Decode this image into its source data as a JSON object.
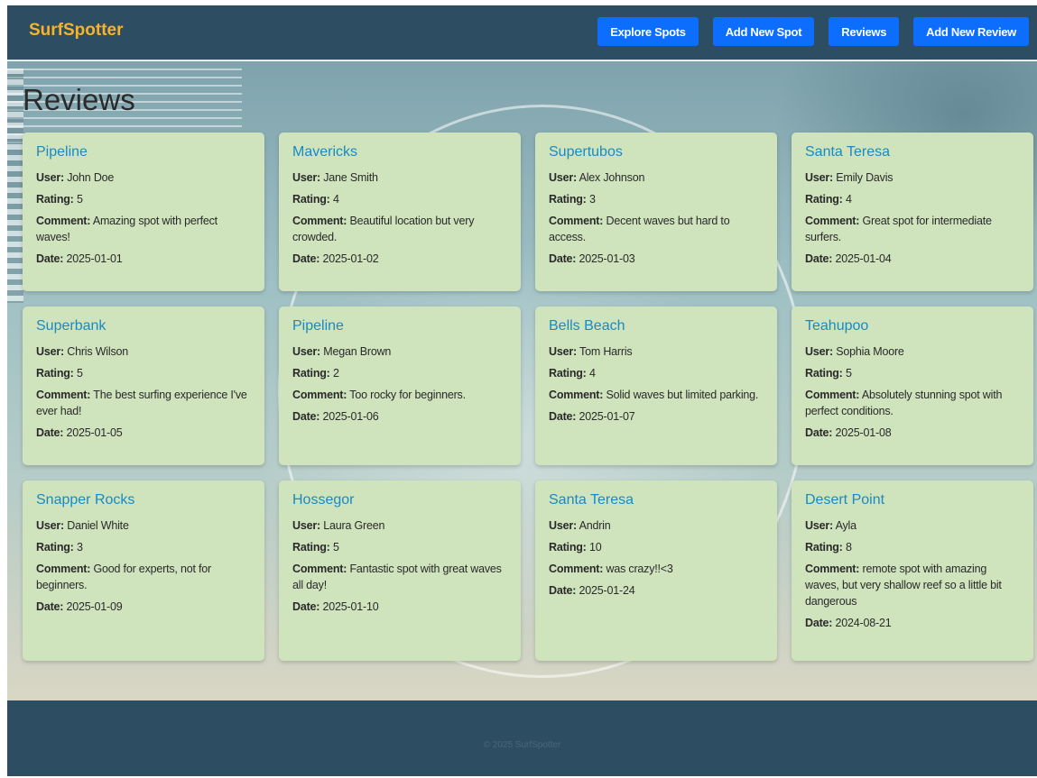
{
  "header": {
    "brand": "SurfSpotter",
    "nav": [
      "Explore Spots",
      "Add New Spot",
      "Reviews",
      "Add New Review"
    ]
  },
  "page": {
    "title": "Reviews"
  },
  "labels": {
    "user": "User:",
    "rating": "Rating:",
    "comment": "Comment:",
    "date": "Date:"
  },
  "reviews": [
    {
      "spot": "Pipeline",
      "user": "John Doe",
      "rating": "5",
      "comment": "Amazing spot with perfect waves!",
      "date": "2025-01-01"
    },
    {
      "spot": "Mavericks",
      "user": "Jane Smith",
      "rating": "4",
      "comment": "Beautiful location but very crowded.",
      "date": "2025-01-02"
    },
    {
      "spot": "Supertubos",
      "user": "Alex Johnson",
      "rating": "3",
      "comment": "Decent waves but hard to access.",
      "date": "2025-01-03"
    },
    {
      "spot": "Santa Teresa",
      "user": "Emily Davis",
      "rating": "4",
      "comment": "Great spot for intermediate surfers.",
      "date": "2025-01-04"
    },
    {
      "spot": "Superbank",
      "user": "Chris Wilson",
      "rating": "5",
      "comment": "The best surfing experience I've ever had!",
      "date": "2025-01-05"
    },
    {
      "spot": "Pipeline",
      "user": "Megan Brown",
      "rating": "2",
      "comment": "Too rocky for beginners.",
      "date": "2025-01-06"
    },
    {
      "spot": "Bells Beach",
      "user": "Tom Harris",
      "rating": "4",
      "comment": "Solid waves but limited parking.",
      "date": "2025-01-07"
    },
    {
      "spot": "Teahupoo",
      "user": "Sophia Moore",
      "rating": "5",
      "comment": "Absolutely stunning spot with perfect conditions.",
      "date": "2025-01-08"
    },
    {
      "spot": "Snapper Rocks",
      "user": "Daniel White",
      "rating": "3",
      "comment": "Good for experts, not for beginners.",
      "date": "2025-01-09"
    },
    {
      "spot": "Hossegor",
      "user": "Laura Green",
      "rating": "5",
      "comment": "Fantastic spot with great waves all day!",
      "date": "2025-01-10"
    },
    {
      "spot": "Santa Teresa",
      "user": "Andrin",
      "rating": "10",
      "comment": "was crazy!!<3",
      "date": "2025-01-24"
    },
    {
      "spot": "Desert Point",
      "user": "Ayla",
      "rating": "8",
      "comment": "remote spot with amazing waves, but very shallow reef so a little bit dangerous",
      "date": "2024-08-21"
    }
  ],
  "footer": {
    "copyright": "© 2025 SurfSpotter"
  }
}
